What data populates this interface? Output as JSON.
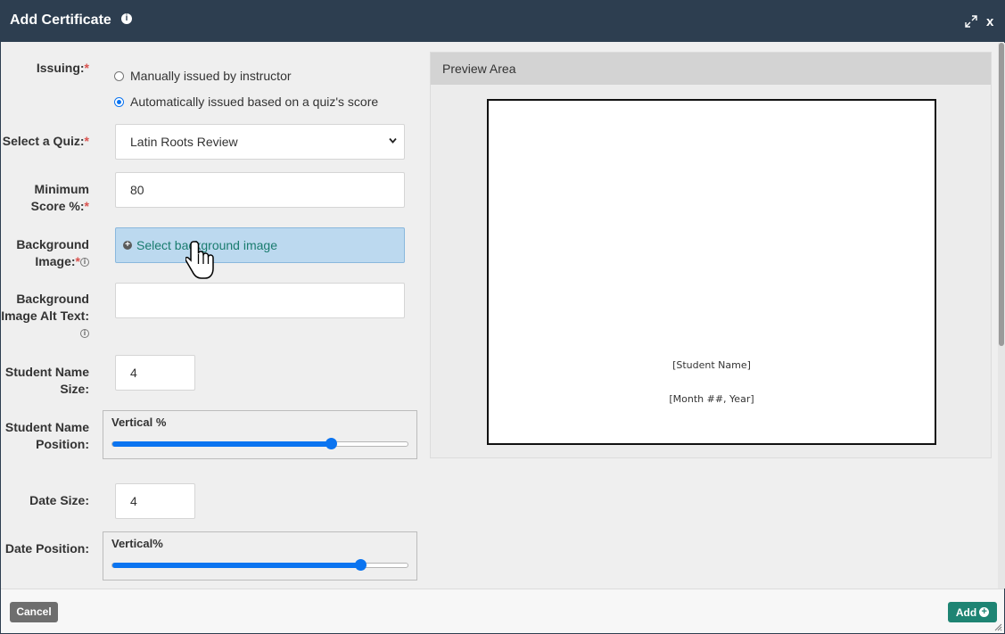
{
  "dialog": {
    "title": "Add Certificate",
    "info_icon": "info-icon",
    "close_label": "x"
  },
  "form": {
    "issuing_label": "Issuing:",
    "issuing_options": [
      {
        "label": "Manually issued by instructor",
        "checked": false
      },
      {
        "label": "Automatically issued based on a quiz's score",
        "checked": true
      }
    ],
    "quiz_label": "Select a Quiz:",
    "quiz_value": "Latin Roots Review",
    "min_score_label_1": "Minimum",
    "min_score_label_2": "Score %:",
    "min_score_value": "80",
    "bg_image_label_1": "Background",
    "bg_image_label_2": "Image:",
    "bg_image_button": "Select background image",
    "alt_text_label_1": "Background",
    "alt_text_label_2": "Image Alt Text:",
    "alt_text_value": "",
    "name_size_label_1": "Student Name",
    "name_size_label_2": "Size:",
    "name_size_value": "4",
    "name_pos_label_1": "Student Name",
    "name_pos_label_2": "Position:",
    "name_pos_slider_title": "Vertical %",
    "name_pos_value": 0.74,
    "date_size_label": "Date Size:",
    "date_size_value": "4",
    "date_pos_label": "Date Position:",
    "date_pos_slider_title": "Vertical%",
    "date_pos_value": 0.84,
    "required_mark": "*"
  },
  "preview": {
    "header": "Preview Area",
    "student_name": "[Student Name]",
    "date": "[Month ##, Year]"
  },
  "footer": {
    "cancel_label": "Cancel",
    "add_label": "Add"
  },
  "colors": {
    "titlebar": "#2d3e50",
    "accent_blue": "#0b74f0",
    "add_green": "#1e8473"
  }
}
